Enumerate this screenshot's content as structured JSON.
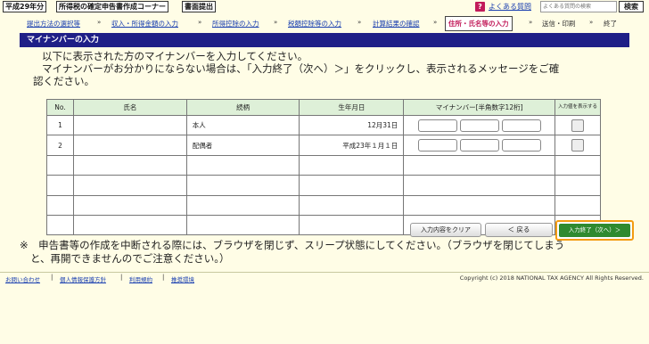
{
  "top_bar": {
    "year_btn": "平成29年分",
    "corner_btn": "所得税の確定申告書作成コーナー",
    "submit_btn": "書面提出",
    "help_icon": "?",
    "help_link": "よくある質問",
    "search_placeholder": "よくある質問の検索",
    "search_btn": "検索"
  },
  "steps": [
    {
      "label": "提出方法の選択等",
      "state": "link"
    },
    {
      "label": "収入・所得金額の入力",
      "state": "link"
    },
    {
      "label": "所得控除の入力",
      "state": "link"
    },
    {
      "label": "税額控除等の入力",
      "state": "link"
    },
    {
      "label": "計算結果の確認",
      "state": "link"
    },
    {
      "label": "住所・氏名等の入力",
      "state": "current"
    },
    {
      "label": "送信・印刷",
      "state": "plain"
    },
    {
      "label": "終了",
      "state": "plain"
    }
  ],
  "step_separator": "»",
  "page_title": "マイナンバーの入力",
  "intro": {
    "line1": "以下に表示された方のマイナンバーを入力してください。",
    "line2": "マイナンバーがお分かりにならない場合は、「入力終了（次へ）＞」をクリックし、表示されるメッセージをご確",
    "line3": "認ください。"
  },
  "table": {
    "headers": [
      "No.",
      "氏名",
      "続柄",
      "生年月日",
      "マイナンバー[半角数字12桁]",
      "入力値を表示する"
    ],
    "rows": [
      {
        "no": "1",
        "name": "",
        "relation": "本人",
        "birth": "12月31日",
        "has_input": true
      },
      {
        "no": "2",
        "name": "",
        "relation": "配偶者",
        "birth": "平成23年１月１日",
        "has_input": true
      },
      {
        "no": "",
        "name": "",
        "relation": "",
        "birth": "",
        "has_input": false
      },
      {
        "no": "",
        "name": "",
        "relation": "",
        "birth": "",
        "has_input": false
      },
      {
        "no": "",
        "name": "",
        "relation": "",
        "birth": "",
        "has_input": false
      },
      {
        "no": "",
        "name": "",
        "relation": "",
        "birth": "",
        "has_input": false
      }
    ]
  },
  "buttons": {
    "clear": "入力内容をクリア",
    "back": "＜ 戻る",
    "next": "入力終了（次へ）＞"
  },
  "notice": {
    "line1": "※　申告書等の作成を中断される際には、ブラウザを閉じず、スリープ状態にしてください。（ブラウザを閉じてしまう",
    "line2": "と、再開できませんのでご注意ください。）"
  },
  "footer": {
    "links": [
      "お問い合わせ",
      "個人情報保護方針",
      "利用規約",
      "推奨環境"
    ],
    "separator": "|",
    "copyright": "Copyright (c) 2018 NATIONAL TAX AGENCY All Rights Reserved."
  },
  "colors": {
    "background": "#fffde6",
    "title_bar": "#1f1f87",
    "header_cell": "#def0d8",
    "link": "#1a3fb0",
    "current_step": "#c21b5a",
    "next_button": "#2f8a2f",
    "next_outline": "#f39c12"
  }
}
